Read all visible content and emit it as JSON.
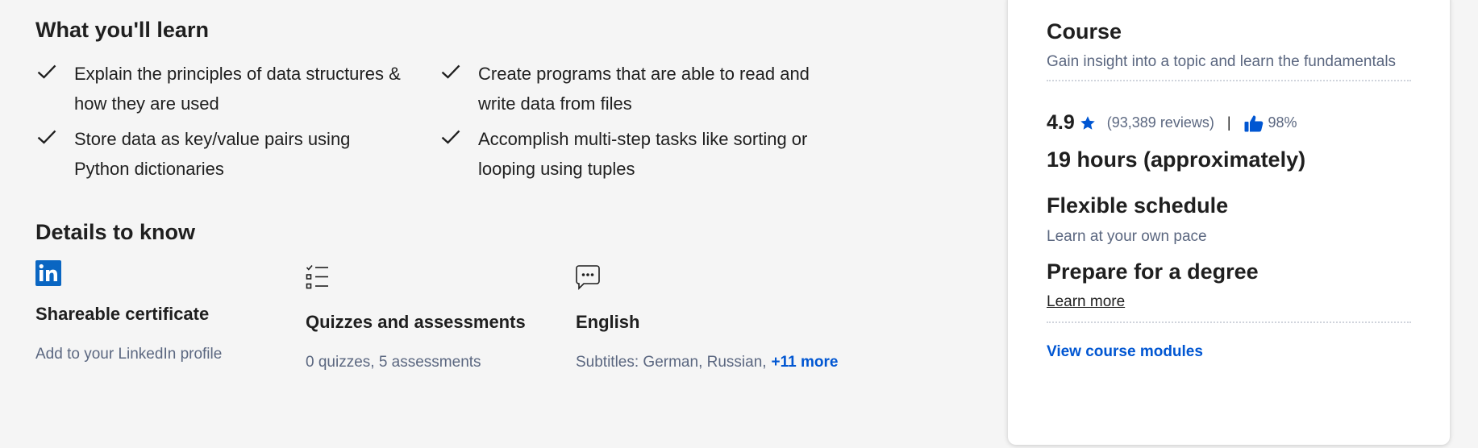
{
  "learn": {
    "heading": "What you'll learn",
    "items": [
      "Explain the principles of data structures & how they are used",
      "Create programs that are able to read and write data from files",
      "Store data as key/value pairs using Python dictionaries",
      "Accomplish multi-step tasks like sorting or looping using tuples"
    ]
  },
  "details": {
    "heading": "Details to know",
    "items": [
      {
        "icon": "linkedin-icon",
        "title": "Shareable certificate",
        "sub": "Add to your LinkedIn profile"
      },
      {
        "icon": "quiz-list-icon",
        "title": "Quizzes and assessments",
        "sub": "0 quizzes, 5 assessments"
      },
      {
        "icon": "chat-bubble-icon",
        "title": "English",
        "sub": "Subtitles: German, Russian,",
        "more": "+11 more"
      }
    ]
  },
  "card": {
    "title": "Course",
    "subtitle": "Gain insight into a topic and learn the fundamentals",
    "rating": "4.9",
    "reviews": "(93,389 reviews)",
    "separator": "|",
    "like_pct": "98%",
    "duration": "19 hours (approximately)",
    "schedule_title": "Flexible schedule",
    "schedule_sub": "Learn at your own pace",
    "degree_title": "Prepare for a degree",
    "degree_link": "Learn more",
    "modules_link": "View course modules"
  },
  "colors": {
    "accent": "#0056d2",
    "linkedin": "#0a66c2",
    "muted_text": "#5b6780",
    "text": "#1f1f1f"
  }
}
